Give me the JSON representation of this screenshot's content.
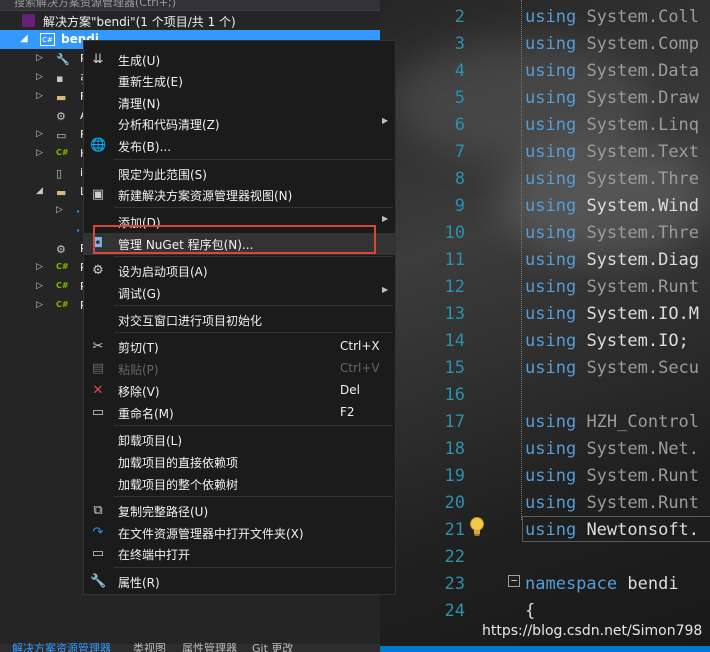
{
  "solution_explorer": {
    "search_placeholder": "搜索解决方案资源管理器(Ctrl+;)",
    "solution_label": "解决方案\"bendi\"(1 个项目/共 1 个)",
    "project_name": "bendi",
    "project_icon_text": "C#",
    "children": [
      {
        "icon": "wrench-icon",
        "stub": "P"
      },
      {
        "icon": "references-icon",
        "stub": "引"
      },
      {
        "icon": "folder-icon",
        "stub": "F"
      },
      {
        "icon": "config-icon",
        "stub": "A"
      },
      {
        "icon": "form-icon",
        "stub": "F"
      },
      {
        "icon": "csharp-file-icon",
        "stub": "H"
      },
      {
        "icon": "file-icon",
        "stub": "i"
      },
      {
        "icon": "folder-icon",
        "stub": "L"
      },
      {
        "icon": "ref-item-icon",
        "stub": "L"
      },
      {
        "icon": "ref-item-icon",
        "stub": "L"
      },
      {
        "icon": "config-icon",
        "stub": "P"
      },
      {
        "icon": "csharp-file-icon",
        "stub": "P"
      },
      {
        "icon": "csharp-file-icon",
        "stub": "P"
      },
      {
        "icon": "csharp-file-icon",
        "stub": "P"
      }
    ],
    "bottom_tabs": [
      "解决方案资源管理器",
      "类视图",
      "属性管理器",
      "Git 更改"
    ]
  },
  "context_menu": {
    "items": [
      {
        "name": "build",
        "icon": "build-icon",
        "label": "生成(U)"
      },
      {
        "name": "rebuild",
        "icon": "",
        "label": "重新生成(E)"
      },
      {
        "name": "clean",
        "icon": "",
        "label": "清理(N)"
      },
      {
        "name": "analyze",
        "icon": "",
        "label": "分析和代码清理(Z)",
        "submenu": true
      },
      {
        "name": "publish",
        "icon": "globe-icon",
        "label": "发布(B)..."
      },
      {
        "name": "scope",
        "icon": "",
        "label": "限定为此范围(S)"
      },
      {
        "name": "new-view",
        "icon": "new-view-icon",
        "label": "新建解决方案资源管理器视图(N)"
      },
      {
        "name": "add",
        "icon": "",
        "label": "添加(D)",
        "submenu": true
      },
      {
        "name": "manage-nuget",
        "icon": "nuget-icon",
        "label": "管理 NuGet 程序包(N)..."
      },
      {
        "name": "set-startup",
        "icon": "gear-icon",
        "label": "设为启动项目(A)"
      },
      {
        "name": "debug",
        "icon": "",
        "label": "调试(G)",
        "submenu": true
      },
      {
        "name": "init-interactive",
        "icon": "",
        "label": "对交互窗口进行项目初始化"
      },
      {
        "name": "cut",
        "icon": "scissors-icon",
        "label": "剪切(T)",
        "shortcut": "Ctrl+X"
      },
      {
        "name": "paste",
        "icon": "paste-icon",
        "label": "粘贴(P)",
        "shortcut": "Ctrl+V",
        "disabled": true
      },
      {
        "name": "remove",
        "icon": "close-icon",
        "label": "移除(V)",
        "shortcut": "Del"
      },
      {
        "name": "rename",
        "icon": "rename-icon",
        "label": "重命名(M)",
        "shortcut": "F2"
      },
      {
        "name": "unload",
        "icon": "",
        "label": "卸载项目(L)"
      },
      {
        "name": "load-direct",
        "icon": "",
        "label": "加载项目的直接依赖项"
      },
      {
        "name": "load-tree",
        "icon": "",
        "label": "加载项目的整个依赖树"
      },
      {
        "name": "copy-path",
        "icon": "copy-icon",
        "label": "复制完整路径(U)"
      },
      {
        "name": "open-folder",
        "icon": "refresh-arrow-icon",
        "label": "在文件资源管理器中打开文件夹(X)"
      },
      {
        "name": "open-terminal",
        "icon": "terminal-icon",
        "label": "在终端中打开"
      },
      {
        "name": "properties",
        "icon": "wrench-icon",
        "label": "属性(R)"
      }
    ]
  },
  "editor": {
    "lines": [
      {
        "n": "2",
        "kw": "using",
        "ns": "System.Coll",
        "dim": true
      },
      {
        "n": "3",
        "kw": "using",
        "ns": "System.Comp",
        "dim": true
      },
      {
        "n": "4",
        "kw": "using",
        "ns": "System.Data",
        "dim": true
      },
      {
        "n": "5",
        "kw": "using",
        "ns": "System.Draw",
        "dim": true
      },
      {
        "n": "6",
        "kw": "using",
        "ns": "System.Linq",
        "dim": true
      },
      {
        "n": "7",
        "kw": "using",
        "ns": "System.Text",
        "dim": true
      },
      {
        "n": "8",
        "kw": "using",
        "ns": "System.Thre",
        "dim": true
      },
      {
        "n": "9",
        "kw": "using",
        "ns": "System.Wind",
        "dim": false
      },
      {
        "n": "10",
        "kw": "using",
        "ns": "System.Thre",
        "dim": true
      },
      {
        "n": "11",
        "kw": "using",
        "ns": "System.Diag",
        "dim": false
      },
      {
        "n": "12",
        "kw": "using",
        "ns": "System.Runt",
        "dim": true
      },
      {
        "n": "13",
        "kw": "using",
        "ns": "System.IO.M",
        "dim": false
      },
      {
        "n": "14",
        "kw": "using",
        "ns": "System.IO;",
        "dim": false
      },
      {
        "n": "15",
        "kw": "using",
        "ns": "System.Secu",
        "dim": true
      },
      {
        "n": "16",
        "kw": "",
        "ns": "",
        "dim": false
      },
      {
        "n": "17",
        "kw": "using",
        "ns": "HZH_Control",
        "dim": true
      },
      {
        "n": "18",
        "kw": "using",
        "ns": "System.Net.",
        "dim": true
      },
      {
        "n": "19",
        "kw": "using",
        "ns": "System.Runt",
        "dim": true
      },
      {
        "n": "20",
        "kw": "using",
        "ns": "System.Runt",
        "dim": true
      },
      {
        "n": "21",
        "kw": "using",
        "ns": "Newtonsoft.",
        "dim": false
      },
      {
        "n": "22",
        "kw": "",
        "ns": "",
        "dim": false
      },
      {
        "n": "23",
        "kw": "namespace",
        "ns": "bendi",
        "dim": false
      },
      {
        "n": "24",
        "kw": "",
        "ns": "{",
        "dim": false
      }
    ]
  },
  "watermark": "https://blog.csdn.net/Simon798",
  "colors": {
    "keyword": "#569cd6",
    "line_number": "#2b91af",
    "selection": "#3399ff",
    "highlight_box": "#d9463e"
  }
}
